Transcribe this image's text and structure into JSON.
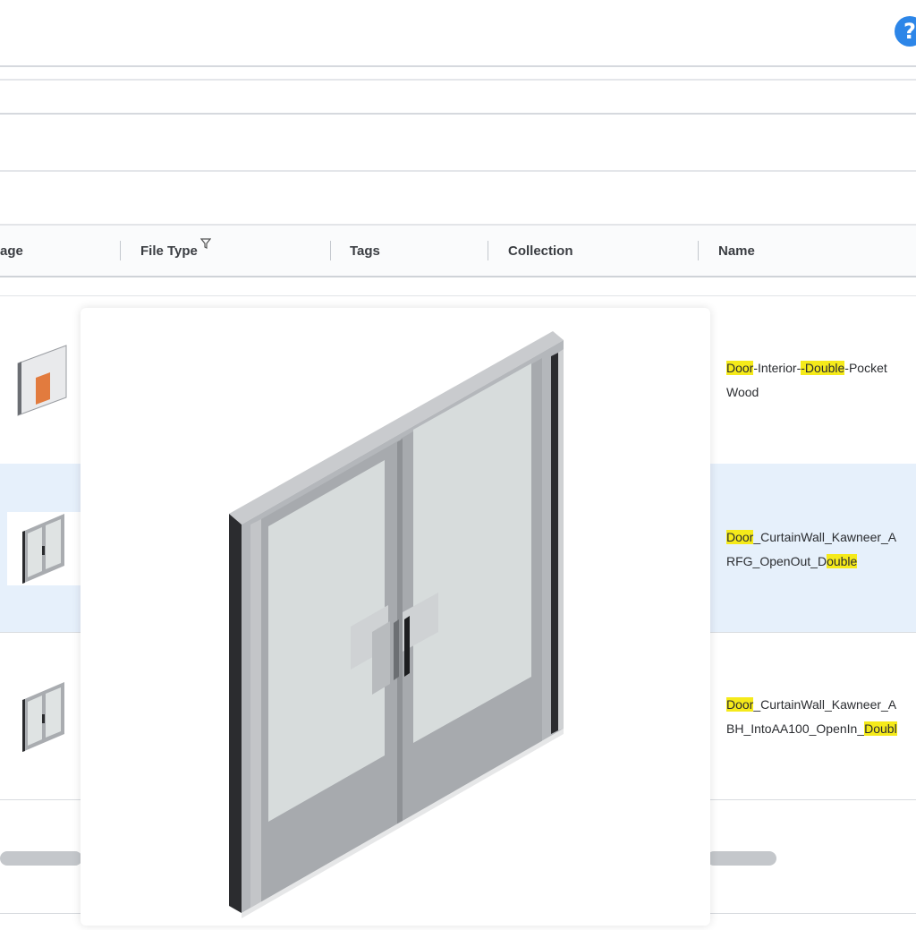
{
  "help": {
    "label": "?"
  },
  "table": {
    "columns": [
      {
        "label": "age"
      },
      {
        "label": "File Type",
        "filter_icon": "filter-icon"
      },
      {
        "label": "Tags"
      },
      {
        "label": "Collection"
      },
      {
        "label": "Name"
      }
    ],
    "rows": [
      {
        "selected": false,
        "name_lines": [
          [
            {
              "t": "Door",
              "h": true
            },
            {
              "t": "-Interior-",
              "h": false
            },
            {
              "t": "-Double",
              "h": true
            },
            {
              "t": "-Pocket",
              "h": false
            }
          ],
          [
            {
              "t": "Wood",
              "h": false
            }
          ]
        ]
      },
      {
        "selected": true,
        "name_lines": [
          [
            {
              "t": "Door",
              "h": true
            },
            {
              "t": "_CurtainWall_Kawneer_A",
              "h": false
            }
          ],
          [
            {
              "t": "RFG_OpenOut_D",
              "h": false
            },
            {
              "t": "ouble",
              "h": true
            }
          ]
        ]
      },
      {
        "selected": false,
        "name_lines": [
          [
            {
              "t": "Door",
              "h": true
            },
            {
              "t": "_CurtainWall_Kawneer_A",
              "h": false
            }
          ],
          [
            {
              "t": "BH_IntoAA100_OpenIn_",
              "h": false
            },
            {
              "t": "Doubl",
              "h": true
            }
          ]
        ]
      }
    ]
  },
  "colors": {
    "accent": "#2d86e8",
    "highlight": "#f5ea1a",
    "selected_row": "#e6f0fb"
  }
}
